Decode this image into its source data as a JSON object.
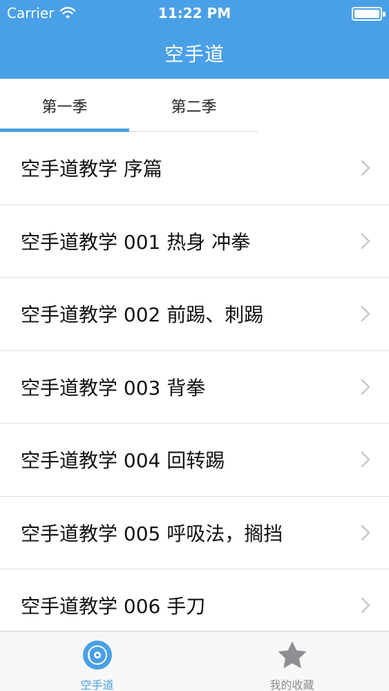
{
  "status_bar": {
    "carrier": "Carrier",
    "time": "11:22 PM",
    "wifi_icon": "wifi-icon",
    "battery_icon": "battery-icon"
  },
  "nav": {
    "title": "空手道"
  },
  "season_tabs": [
    {
      "label": "第一季",
      "selected": true
    },
    {
      "label": "第二季",
      "selected": false
    }
  ],
  "list": {
    "items": [
      {
        "title": "空手道教学 序篇"
      },
      {
        "title": "空手道教学 001 热身 冲拳"
      },
      {
        "title": "空手道教学 002 前踢、刺踢"
      },
      {
        "title": "空手道教学 003 背拳"
      },
      {
        "title": "空手道教学 004 回转踢"
      },
      {
        "title": "空手道教学 005 呼吸法，搁挡"
      },
      {
        "title": "空手道教学 006 手刀"
      }
    ],
    "chevron_icon": "chevron-right-icon"
  },
  "tab_bar": {
    "items": [
      {
        "label": "空手道",
        "icon": "disc-icon",
        "selected": true
      },
      {
        "label": "我的收藏",
        "icon": "star-icon",
        "selected": false
      }
    ]
  },
  "colors": {
    "accent": "#4aa0e6",
    "inactive": "#8e8e93"
  }
}
